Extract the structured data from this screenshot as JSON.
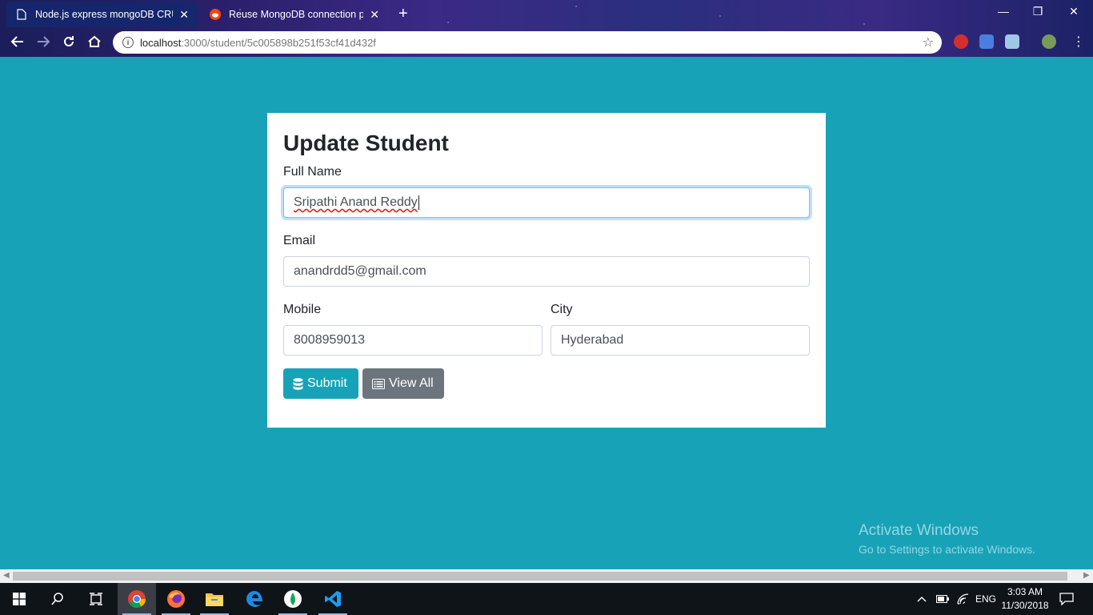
{
  "browser": {
    "tabs": [
      {
        "title": "Node.js express mongoDB CRUD",
        "active": true
      },
      {
        "title": "Reuse MongoDB connection pro",
        "active": false
      }
    ],
    "url_host": "localhost",
    "url_path": ":3000/student/5c005898b251f53cf41d432f"
  },
  "form": {
    "title": "Update Student",
    "full_name_label": "Full Name",
    "full_name_value": "Sripathi Anand Reddy",
    "email_label": "Email",
    "email_value": "anandrdd5@gmail.com",
    "mobile_label": "Mobile",
    "mobile_value": "8008959013",
    "city_label": "City",
    "city_value": "Hyderabad",
    "submit_label": "Submit",
    "view_all_label": "View All"
  },
  "colors": {
    "page_bg": "#17a2b8",
    "submit_bg": "#17a2b8",
    "view_all_bg": "#6c757d"
  },
  "watermark": {
    "line1": "Activate Windows",
    "line2": "Go to Settings to activate Windows."
  },
  "taskbar": {
    "lang": "ENG",
    "time": "3:03 AM",
    "date": "11/30/2018",
    "apps": [
      "chrome-icon",
      "firefox-icon",
      "file-explorer-icon",
      "edge-icon",
      "mongodb-compass-icon",
      "vscode-icon"
    ]
  }
}
